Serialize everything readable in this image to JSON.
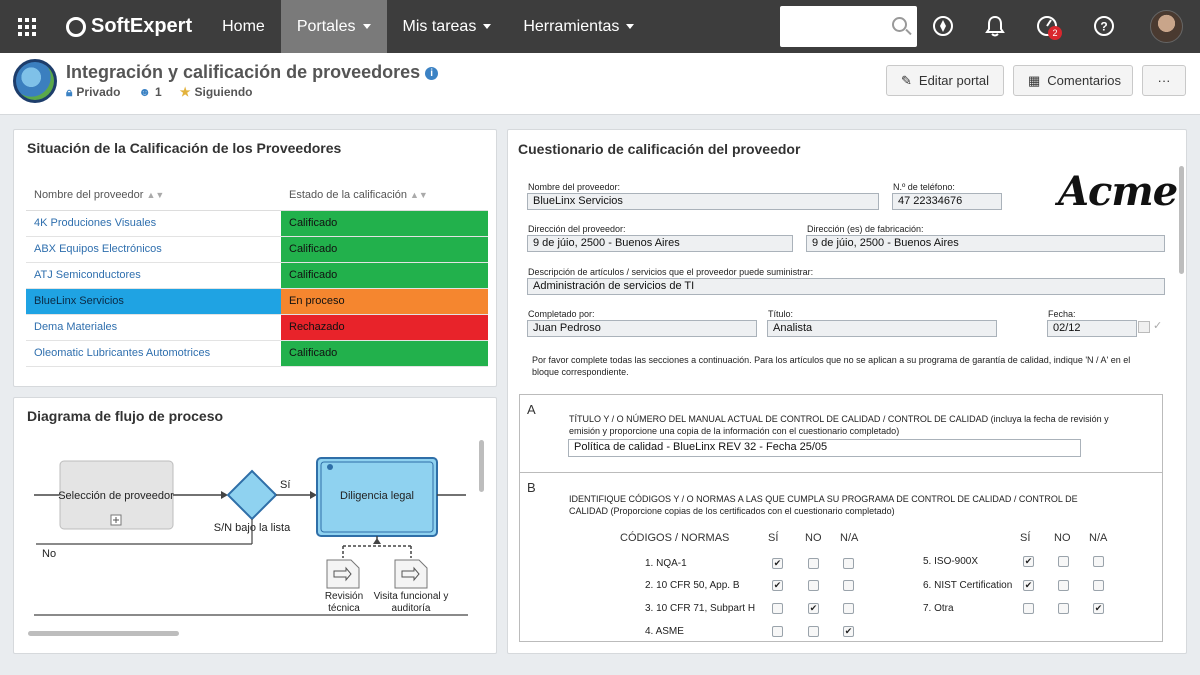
{
  "topnav": {
    "brand": "SoftExpert",
    "items": [
      {
        "label": "Home"
      },
      {
        "label": "Portales"
      },
      {
        "label": "Mis tareas"
      },
      {
        "label": "Herramientas"
      }
    ],
    "search_placeholder": "",
    "notification_badge": "2"
  },
  "header": {
    "title": "Integración y calificación de proveedores",
    "privacy": "Privado",
    "members": "1",
    "following": "Siguiendo",
    "edit_button": "Editar portal",
    "comments_button": "Comentarios",
    "more_button": "···"
  },
  "suppliers": {
    "title": "Situación de la Calificación de los Proveedores",
    "columns": [
      "Nombre del proveedor",
      "Estado de la calificación"
    ],
    "rows": [
      {
        "name": "4K Produciones Visuales",
        "status": "Calificado",
        "color": "#22b14c"
      },
      {
        "name": "ABX Equipos Electrónicos",
        "status": "Calificado",
        "color": "#22b14c"
      },
      {
        "name": "ATJ Semiconductores",
        "status": "Calificado",
        "color": "#22b14c"
      },
      {
        "name": "BlueLinx Servicios",
        "status": "En proceso",
        "color": "#f5862f",
        "selected": true
      },
      {
        "name": "Dema Materiales",
        "status": "Rechazado",
        "color": "#e8232a"
      },
      {
        "name": "Oleomatic Lubricantes Automotrices",
        "status": "Calificado",
        "color": "#22b14c"
      }
    ],
    "selected_color": "#1fa3e3"
  },
  "flow": {
    "title": "Diagrama de flujo de proceso",
    "task1": "Selección de proveedor",
    "gateway_label": "S/N bajo la lista",
    "yes": "Sí",
    "no": "No",
    "task2": "Diligencia legal",
    "doc1_line1": "Revisión",
    "doc1_line2": "técnica",
    "doc2_line1": "Visita funcional y",
    "doc2_line2": "auditoría"
  },
  "form": {
    "title": "Cuestionario de calificación del proveedor",
    "logo": "Acme",
    "supplier_name_label": "Nombre del proveedor:",
    "supplier_name": "BlueLinx Servicios",
    "phone_label": "N.º de teléfono:",
    "phone": "47 22334676",
    "address_label": "Dirección del proveedor:",
    "address": "9 de júio, 2500 - Buenos Aires",
    "mfg_address_label": "Dirección (es) de fabricación:",
    "mfg_address": "9 de júio, 2500 - Buenos Aires",
    "items_label": "Descripción de artículos / servicios que el proveedor puede suministrar:",
    "items": "Administración de servicios de TI",
    "completed_by_label": "Completado por:",
    "completed_by": "Juan Pedroso",
    "role_label": "Título:",
    "role": "Analista",
    "date_label": "Fecha:",
    "date": "02/12",
    "instructions": "Por favor complete todas las secciones a continuación. Para los artículos que no se aplican a su programa de garantía de calidad, indique 'N / A' en el bloque correspondiente.",
    "sectionA_letter": "A",
    "sectionA_text": "TÍTULO Y / O NÚMERO DEL MANUAL ACTUAL DE CONTROL DE CALIDAD / CONTROL DE CALIDAD (incluya la fecha de revisión y emisión y proporcione una copia de la información con el cuestionario completado)",
    "sectionA_value": "Política de calidad - BlueLinx REV 32 - Fecha 25/05",
    "sectionB_letter": "B",
    "sectionB_text": "IDENTIFIQUE CÓDIGOS Y / O NORMAS A LAS QUE CUMPLA SU PROGRAMA DE CONTROL DE CALIDAD / CONTROL DE CALIDAD (Proporcione copias de los certificados con el cuestionario completado)",
    "codes_header": "CÓDIGOS / NORMAS",
    "yes": "SÍ",
    "no": "NO",
    "na": "N/A",
    "codes_left": [
      {
        "label": "1. NQA-1",
        "answer": "yes"
      },
      {
        "label": "2. 10 CFR 50, App. B",
        "answer": "yes"
      },
      {
        "label": "3. 10 CFR 71, Subpart H",
        "answer": "no"
      },
      {
        "label": "4. ASME",
        "answer": "na"
      }
    ],
    "codes_right": [
      {
        "label": "5. ISO-900X",
        "answer": "yes"
      },
      {
        "label": "6. NIST Certification",
        "answer": "yes"
      },
      {
        "label": "7. Otra",
        "answer": "na"
      }
    ]
  }
}
